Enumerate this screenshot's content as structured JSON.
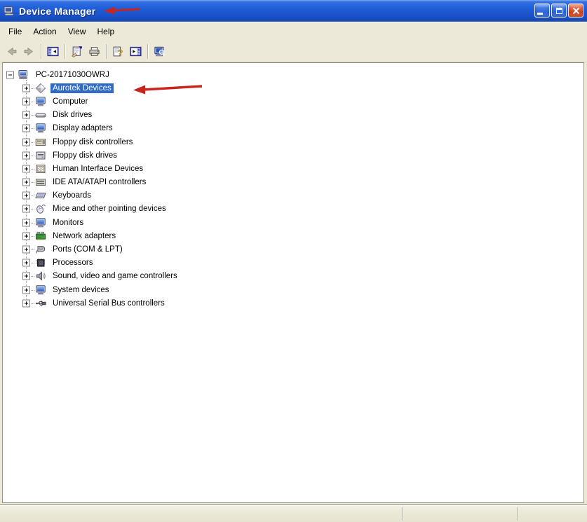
{
  "window": {
    "title": "Device Manager",
    "app_icon": "device-manager",
    "controls": [
      "minimize",
      "maximize",
      "close"
    ]
  },
  "menu": {
    "items": [
      {
        "label": "File"
      },
      {
        "label": "Action"
      },
      {
        "label": "View"
      },
      {
        "label": "Help"
      }
    ]
  },
  "toolbar": {
    "buttons": [
      {
        "name": "back",
        "icon": "arrow-left",
        "disabled": true
      },
      {
        "name": "forward",
        "icon": "arrow-right",
        "disabled": true,
        "sep_after": true
      },
      {
        "name": "show-hide-console-tree",
        "icon": "console-tree",
        "sep_after": true
      },
      {
        "name": "properties",
        "icon": "properties"
      },
      {
        "name": "print",
        "icon": "print",
        "sep_after": true
      },
      {
        "name": "help",
        "icon": "help"
      },
      {
        "name": "show-hide-action-pane",
        "icon": "action-pane",
        "sep_after": true
      },
      {
        "name": "scan-for-hardware-changes",
        "icon": "scan"
      }
    ]
  },
  "tree": {
    "root": {
      "label": "PC-20171030OWRJ",
      "icon": "computer",
      "expanded": true
    },
    "items": [
      {
        "label": "Aurotek Devices",
        "icon": "diamond",
        "selected": true
      },
      {
        "label": "Computer",
        "icon": "computer-node"
      },
      {
        "label": "Disk drives",
        "icon": "disk-drive"
      },
      {
        "label": "Display adapters",
        "icon": "display-adapter"
      },
      {
        "label": "Floppy disk controllers",
        "icon": "floppy-controller"
      },
      {
        "label": "Floppy disk drives",
        "icon": "floppy-drive"
      },
      {
        "label": "Human Interface Devices",
        "icon": "hid"
      },
      {
        "label": "IDE ATA/ATAPI controllers",
        "icon": "ide-controller"
      },
      {
        "label": "Keyboards",
        "icon": "keyboard"
      },
      {
        "label": "Mice and other pointing devices",
        "icon": "mouse"
      },
      {
        "label": "Monitors",
        "icon": "monitor"
      },
      {
        "label": "Network adapters",
        "icon": "network-adapter"
      },
      {
        "label": "Ports (COM & LPT)",
        "icon": "port"
      },
      {
        "label": "Processors",
        "icon": "processor"
      },
      {
        "label": "Sound, video and game controllers",
        "icon": "sound"
      },
      {
        "label": "System devices",
        "icon": "system-device"
      },
      {
        "label": "Universal Serial Bus controllers",
        "icon": "usb"
      }
    ]
  },
  "annotations": [
    {
      "name": "red-arrow-title",
      "points_at": "window-title"
    },
    {
      "name": "red-arrow-tree",
      "points_at": "Aurotek Devices"
    }
  ],
  "colors": {
    "titlebar_blue": "#2363DB",
    "selection_blue": "#316AC5",
    "chrome_beige": "#ECE9D8",
    "annotation_red": "#C8251D",
    "close_button_red": "#CF4118"
  }
}
